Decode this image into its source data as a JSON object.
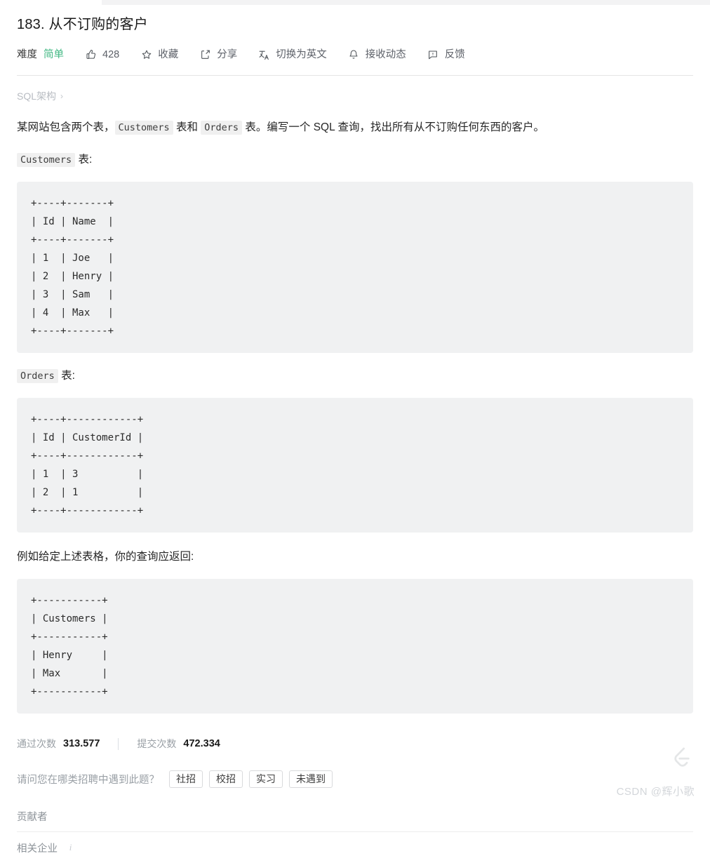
{
  "problem": {
    "title": "183. 从不订购的客户",
    "difficulty_label": "难度",
    "difficulty_value": "简单"
  },
  "toolbar": {
    "likes": "428",
    "favorite": "收藏",
    "share": "分享",
    "translate": "切换为英文",
    "subscribe": "接收动态",
    "feedback": "反馈"
  },
  "breadcrumb": {
    "text": "SQL架构",
    "chevron": "›"
  },
  "description": {
    "part1": "某网站包含两个表，",
    "code1": "Customers",
    "part2": " 表和 ",
    "code2": "Orders",
    "part3": " 表。编写一个 SQL 查询，找出所有从不订购任何东西的客户。",
    "customers_label_code": "Customers",
    "customers_label_suffix": " 表:",
    "orders_label_code": "Orders",
    "orders_label_suffix": " 表:",
    "result_intro": "例如给定上述表格，你的查询应返回:"
  },
  "code_blocks": {
    "customers": "+----+-------+\n| Id | Name  |\n+----+-------+\n| 1  | Joe   |\n| 2  | Henry |\n| 3  | Sam   |\n| 4  | Max   |\n+----+-------+",
    "orders": "+----+------------+\n| Id | CustomerId |\n+----+------------+\n| 1  | 3          |\n| 2  | 1          |\n+----+------------+",
    "result": "+-----------+\n| Customers |\n+-----------+\n| Henry     |\n| Max       |\n+-----------+"
  },
  "stats": {
    "pass_label": "通过次数",
    "pass_value": "313.577",
    "submit_label": "提交次数",
    "submit_value": "472.334"
  },
  "tags": {
    "question": "请问您在哪类招聘中遇到此题？",
    "options": [
      "社招",
      "校招",
      "实习",
      "未遇到"
    ]
  },
  "footer": {
    "contributors": "贡献者",
    "companies": "相关企业"
  },
  "watermark": {
    "text": "CSDN @辉小歌"
  }
}
